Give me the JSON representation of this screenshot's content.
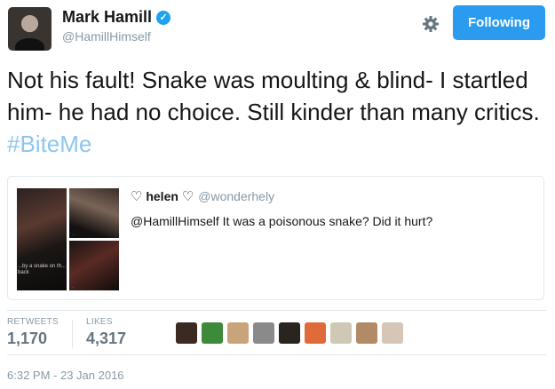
{
  "author": {
    "name": "Mark Hamill",
    "handle": "@HamillHimself",
    "verified_icon": "verified-check-icon"
  },
  "follow_button_label": "Following",
  "colors": {
    "accent": "#2b9bf0",
    "hashtag": "#8ec6ee",
    "muted": "#8899a6"
  },
  "tweet": {
    "text": "Not his fault! Snake was moulting & blind- I startled him- he had no choice. Still kinder than many critics. ",
    "hashtag": "#BiteMe"
  },
  "quoted_tweet": {
    "name_prefix_icon": "♡",
    "name": "helen",
    "name_suffix_icon": "♡",
    "handle": "@wonderhely",
    "text": "@HamillHimself  It was a poisonous snake? Did it hurt?",
    "media_captions": [
      "...by a snake on th... back",
      "...",
      "..."
    ]
  },
  "stats": {
    "retweets_label": "RETWEETS",
    "retweets_value": "1,170",
    "likes_label": "LIKES",
    "likes_value": "4,317"
  },
  "liker_avatars": [
    {
      "color": "#3a2a22"
    },
    {
      "color": "#3d8a3a"
    },
    {
      "color": "#c9a47a"
    },
    {
      "color": "#8a8a8a"
    },
    {
      "color": "#2a241e"
    },
    {
      "color": "#e06a3a"
    },
    {
      "color": "#cfc8b4"
    },
    {
      "color": "#b38a68"
    },
    {
      "color": "#d7c5b5"
    }
  ],
  "timestamp": "6:32 PM - 23 Jan 2016"
}
